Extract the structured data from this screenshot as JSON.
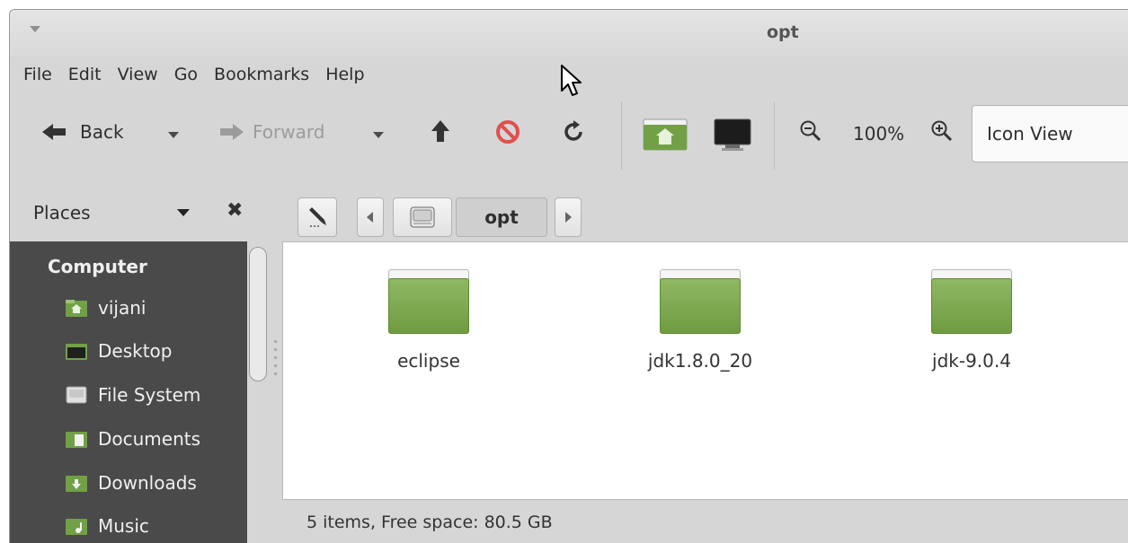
{
  "window": {
    "title": "opt"
  },
  "menubar": [
    "File",
    "Edit",
    "View",
    "Go",
    "Bookmarks",
    "Help"
  ],
  "toolbar": {
    "back_label": "Back",
    "forward_label": "Forward",
    "zoom_level": "100%",
    "view_mode": "Icon View"
  },
  "location": {
    "places_label": "Places",
    "crumb_current": "opt"
  },
  "sidebar": {
    "heading": "Computer",
    "items": [
      {
        "label": "vijani",
        "icon": "home-folder-icon"
      },
      {
        "label": "Desktop",
        "icon": "desktop-icon"
      },
      {
        "label": "File System",
        "icon": "drive-icon"
      },
      {
        "label": "Documents",
        "icon": "documents-folder-icon"
      },
      {
        "label": "Downloads",
        "icon": "downloads-folder-icon"
      },
      {
        "label": "Music",
        "icon": "music-folder-icon"
      }
    ]
  },
  "files": [
    {
      "name": "eclipse",
      "icon": "folder-icon"
    },
    {
      "name": "jdk1.8.0_20",
      "icon": "folder-icon"
    },
    {
      "name": "jdk-9.0.4",
      "icon": "folder-icon"
    }
  ],
  "status": {
    "text": "5 items, Free space: 80.5 GB"
  },
  "colors": {
    "folder_green": "#7da74d",
    "sidebar_bg": "#4a4a4a",
    "stop_red": "#e0504f"
  }
}
